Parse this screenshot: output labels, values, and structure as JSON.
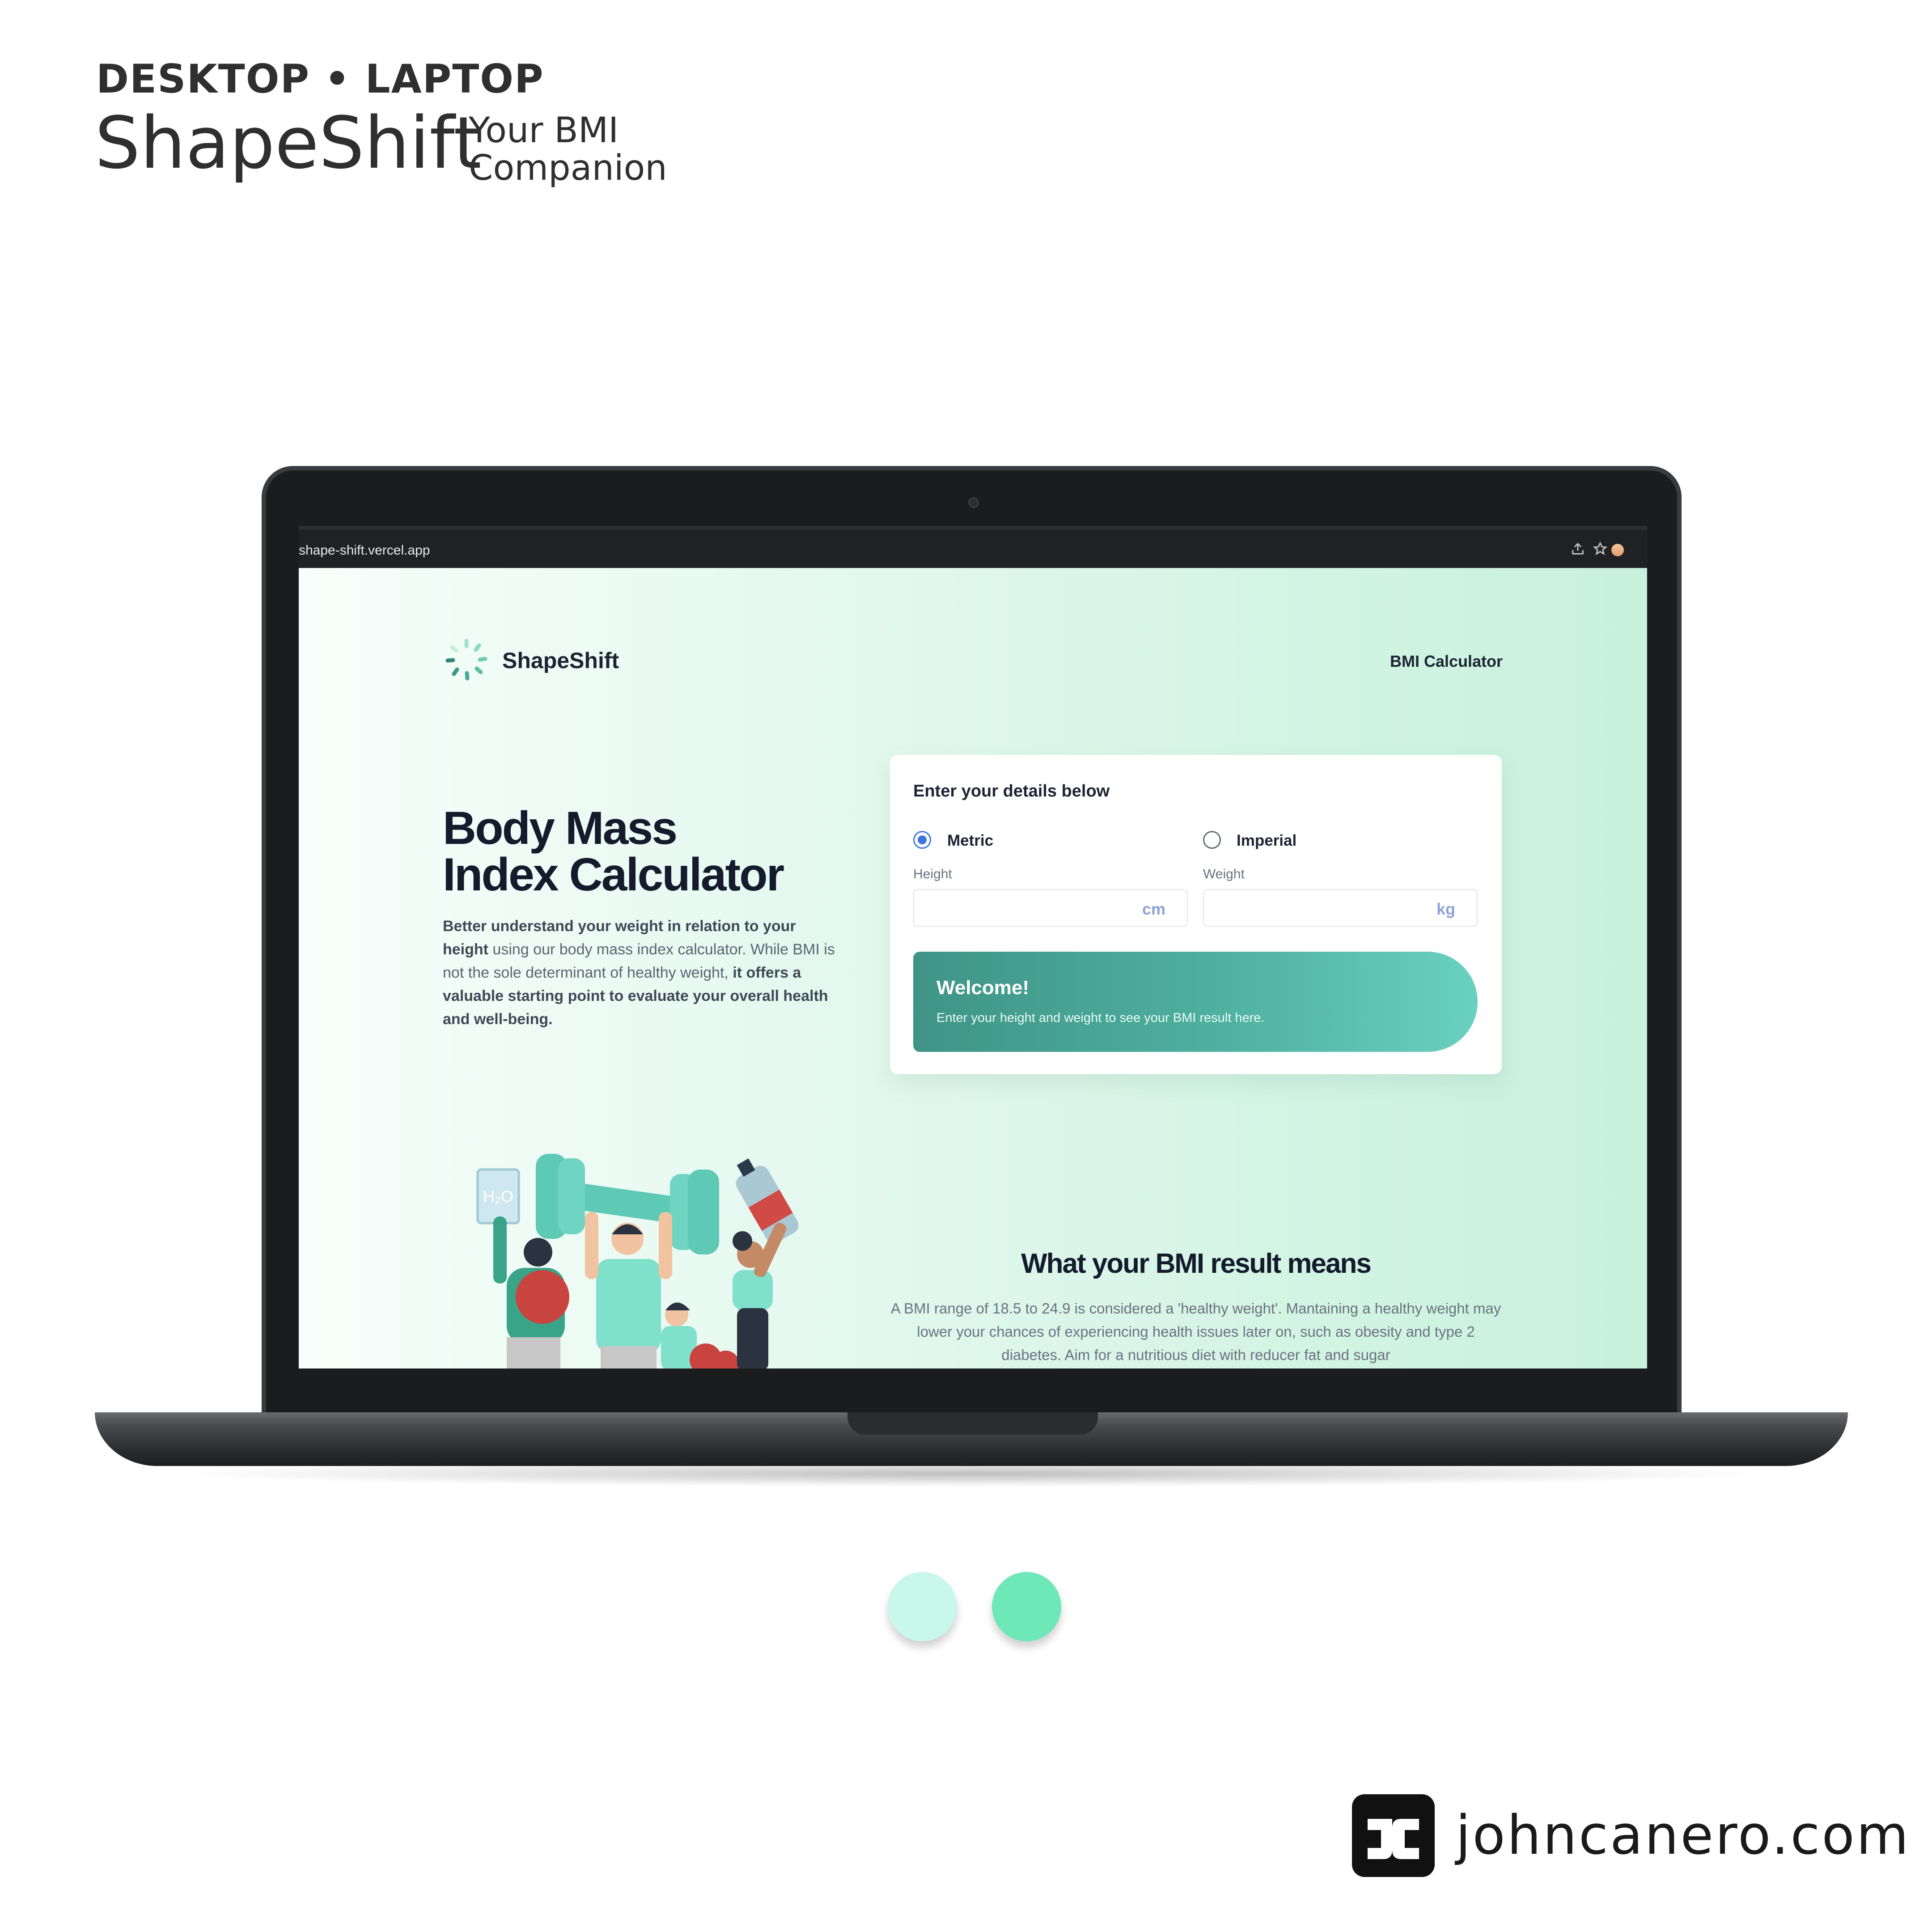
{
  "presentation": {
    "eyebrow": "DESKTOP • LAPTOP",
    "title": "ShapeShift",
    "subtitle": "Your BMI Companion",
    "footer_domain": "johncanero.com"
  },
  "browser": {
    "url": "shape-shift.vercel.app",
    "icons": [
      "share-icon",
      "star-icon",
      "profile-icon"
    ]
  },
  "site": {
    "logo_text": "ShapeShift",
    "nav_link": "BMI Calculator",
    "hero": {
      "title_line1": "Body Mass",
      "title_line2": "Index Calculator",
      "desc_bold1": "Better understand your weight in relation to your height",
      "desc_plain1": " using our body mass index calculator. While BMI is not the sole determinant of healthy weight, ",
      "desc_bold2": "it offers a valuable starting point to evaluate your overall health and well-being."
    },
    "form": {
      "title": "Enter your details below",
      "unit_options": [
        "Metric",
        "Imperial"
      ],
      "selected_unit": "Metric",
      "height_label": "Height",
      "height_unit": "cm",
      "height_value": "",
      "weight_label": "Weight",
      "weight_unit": "kg",
      "weight_value": "",
      "result_title": "Welcome!",
      "result_text": "Enter your height and weight to see your BMI result here."
    },
    "meaning": {
      "title": "What your BMI result means",
      "text": "A BMI range of 18.5 to 24.9 is considered a 'healthy weight'. Mantaining a healthy weight may lower your chances of experiencing health issues later on, such as obesity and type 2 diabetes. Aim for a nutritious diet with reducer fat and sugar"
    }
  },
  "palette": {
    "swatch_light": "#c9f7ea",
    "swatch_green": "#6ee8b9"
  }
}
